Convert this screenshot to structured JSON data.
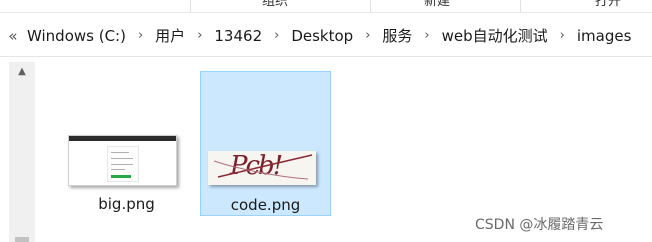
{
  "ribbon": {
    "items": [
      "",
      "组织",
      "新建",
      "打开"
    ]
  },
  "breadcrumb": {
    "overflow_glyph": "«",
    "separator": "›",
    "items": [
      "Windows (C:)",
      "用户",
      "13462",
      "Desktop",
      "服务",
      "web自动化测试",
      "images"
    ]
  },
  "files": [
    {
      "name": "big.png",
      "selected": false
    },
    {
      "name": "code.png",
      "selected": true
    }
  ],
  "thumbnails": {
    "captcha_text": "Pcb!"
  },
  "watermark": "CSDN @冰履踏青云",
  "colors": {
    "selection_bg": "#cce8ff",
    "selection_border": "#99d1ff"
  }
}
